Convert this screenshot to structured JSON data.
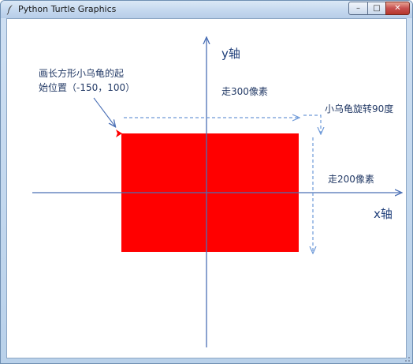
{
  "window": {
    "title": "Python Turtle Graphics",
    "minimize_glyph": "–",
    "maximize_glyph": "□",
    "close_glyph": "✕"
  },
  "annotations": {
    "start_note_line1": "画长方形小乌龟的起",
    "start_note_line2": "始位置（-150，100）",
    "walk_300": "走300像素",
    "turn_90": "小乌龟旋转90度",
    "walk_200": "走200像素",
    "y_axis": "y轴",
    "x_axis": "x轴"
  },
  "colors": {
    "rectangle_fill": "#ff0000",
    "axis": "#4a6fb5",
    "dashed_guide": "#6d99d8",
    "turtle": "#ff0000"
  },
  "icons": {
    "app": "feather-icon",
    "turtle": "turtle-arrow-icon"
  }
}
